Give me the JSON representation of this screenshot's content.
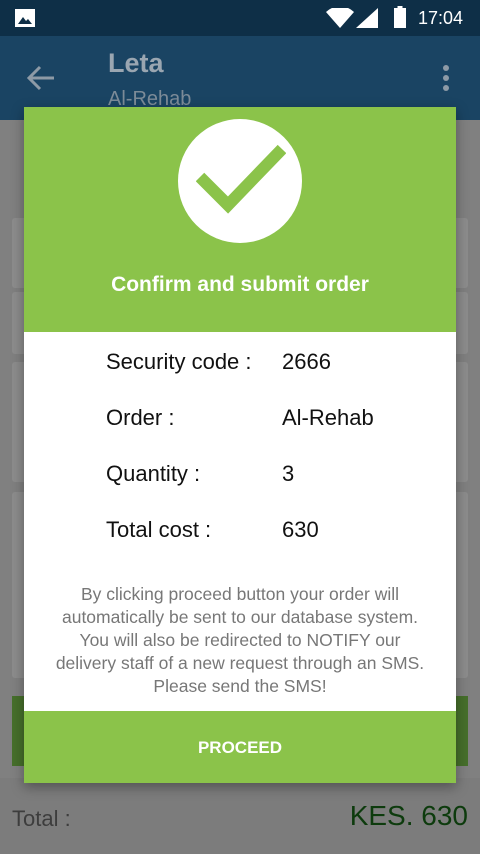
{
  "status_bar": {
    "time": "17:04",
    "icons": [
      "image-icon",
      "wifi-icon",
      "signal-icon",
      "battery-icon"
    ]
  },
  "app_bar": {
    "title": "Leta",
    "subtitle": "Al-Rehab",
    "back_icon": "arrow-back-icon",
    "menu_icon": "more-vert-icon"
  },
  "background": {
    "total_label": "Total :",
    "total_value": "KES.  630"
  },
  "dialog": {
    "heading": "Confirm and submit order",
    "icon": "check-icon",
    "details": [
      {
        "label": "Security code :",
        "value": "2666"
      },
      {
        "label": "Order :",
        "value": "Al-Rehab"
      },
      {
        "label": "Quantity :",
        "value": "3"
      },
      {
        "label": "Total cost :",
        "value": "630"
      }
    ],
    "note_lines": [
      "By clicking proceed button your order will",
      "automatically be sent to our database system.",
      "You will also be redirected to NOTIFY our",
      "delivery staff of a new request through an SMS.",
      "Please send the SMS!"
    ],
    "proceed_label": "PROCEED"
  },
  "colors": {
    "status_bar": "#0e2f47",
    "app_bar": "#1a4463",
    "accent_green": "#8bc34a",
    "dim_overlay": "#808080"
  }
}
